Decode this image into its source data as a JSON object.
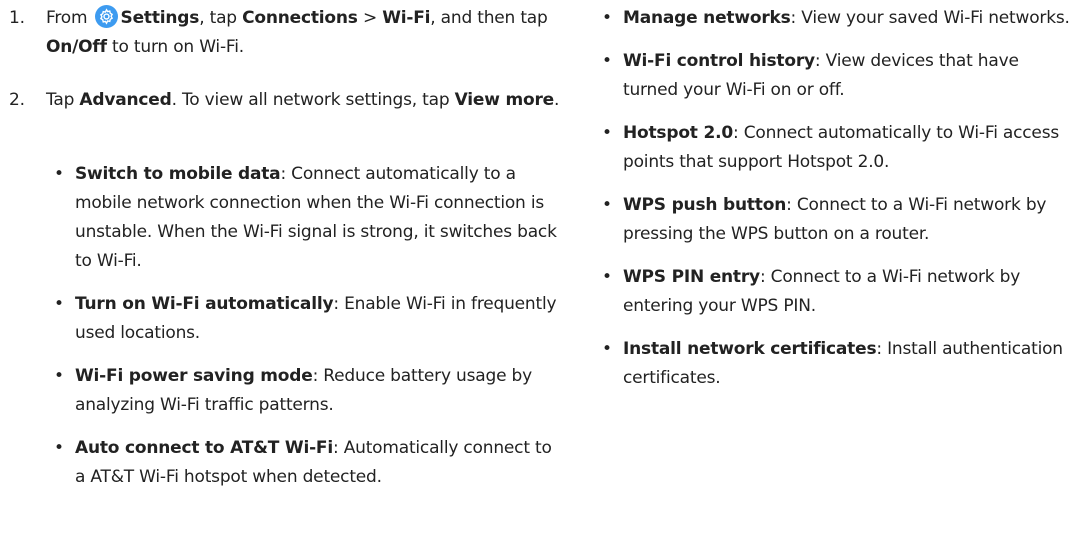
{
  "step1": {
    "number": "1.",
    "from": "From",
    "settings": "Settings",
    "tap": ", tap",
    "connections": "Connections",
    "sep": " > ",
    "wifi": "Wi-Fi",
    "then": ", and then tap",
    "onoff": "On/Off",
    "end": "to turn on Wi-Fi.",
    "icon": "gear-icon",
    "icon_color": "#3d9bf0"
  },
  "step2": {
    "number": "2.",
    "tap": "Tap",
    "advanced": "Advanced",
    "mid": ". To view all network settings, tap",
    "view_more": "View more",
    "end": "."
  },
  "left_bullets": [
    {
      "term": "Switch to mobile data",
      "desc": ": Connect automatically to a mobile network connection when the Wi-Fi connection is unstable. When the Wi-Fi signal is strong, it switches back to Wi-Fi."
    },
    {
      "term": "Turn on Wi-Fi automatically",
      "desc": ": Enable Wi-Fi in frequently used locations."
    },
    {
      "term": "Wi-Fi power saving mode",
      "desc": ": Reduce battery usage by analyzing Wi-Fi traffic patterns."
    },
    {
      "term": "Auto connect to AT&T Wi-Fi",
      "desc": ": Automatically connect to a AT&T Wi-Fi hotspot when detected."
    }
  ],
  "right_bullets": [
    {
      "term": "Manage networks",
      "desc": ": View your saved Wi-Fi networks."
    },
    {
      "term": "Wi-Fi control history",
      "desc": ": View devices that have turned your Wi-Fi on or off."
    },
    {
      "term": "Hotspot 2.0",
      "desc": ": Connect automatically to Wi-Fi access points that support Hotspot 2.0."
    },
    {
      "term": "WPS push button",
      "desc": ": Connect to a Wi-Fi network by pressing the WPS button on a router."
    },
    {
      "term": "WPS PIN entry",
      "desc": ": Connect to a Wi-Fi network by entering your WPS PIN."
    },
    {
      "term": "Install network certificates",
      "desc": ": Install authentication certificates."
    }
  ],
  "bullet": "•"
}
